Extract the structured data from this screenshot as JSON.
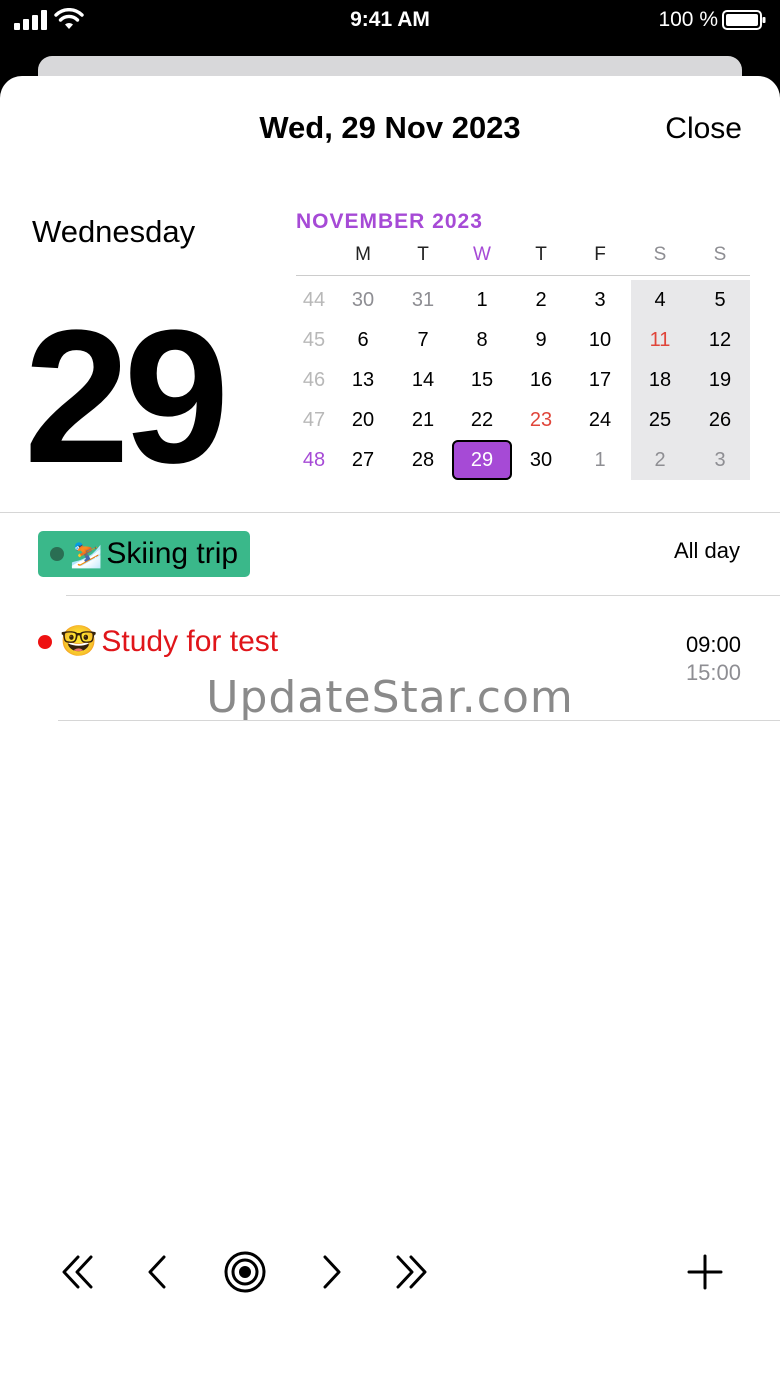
{
  "status": {
    "time": "9:41 AM",
    "battery": "100 %"
  },
  "header": {
    "title": "Wed, 29 Nov 2023",
    "close_label": "Close"
  },
  "day": {
    "weekday": "Wednesday",
    "number": "29"
  },
  "calendar": {
    "month_label": "NOVEMBER 2023",
    "weekday_headers": [
      "M",
      "T",
      "W",
      "T",
      "F",
      "S",
      "S"
    ],
    "weeks": [
      {
        "week": "44",
        "days": [
          "30",
          "31",
          "1",
          "2",
          "3",
          "4",
          "5"
        ]
      },
      {
        "week": "45",
        "days": [
          "6",
          "7",
          "8",
          "9",
          "10",
          "11",
          "12"
        ]
      },
      {
        "week": "46",
        "days": [
          "13",
          "14",
          "15",
          "16",
          "17",
          "18",
          "19"
        ]
      },
      {
        "week": "47",
        "days": [
          "20",
          "21",
          "22",
          "23",
          "24",
          "25",
          "26"
        ]
      },
      {
        "week": "48",
        "days": [
          "27",
          "28",
          "29",
          "30",
          "1",
          "2",
          "3"
        ]
      }
    ],
    "selected": "29",
    "accent_color": "#a64ad6"
  },
  "events": {
    "all_day": {
      "emoji": "⛷️",
      "title": "Skiing trip",
      "time_label": "All day",
      "color": "#3ab88a"
    },
    "timed": {
      "emoji": "🤓",
      "title": "Study for test",
      "start": "09:00",
      "end": "15:00",
      "color": "#e0151a"
    }
  },
  "watermark": "UpdateStar.com",
  "toolbar": {
    "icons": [
      "double-chevron-left-icon",
      "chevron-left-icon",
      "target-icon",
      "chevron-right-icon",
      "double-chevron-right-icon",
      "plus-icon"
    ]
  }
}
